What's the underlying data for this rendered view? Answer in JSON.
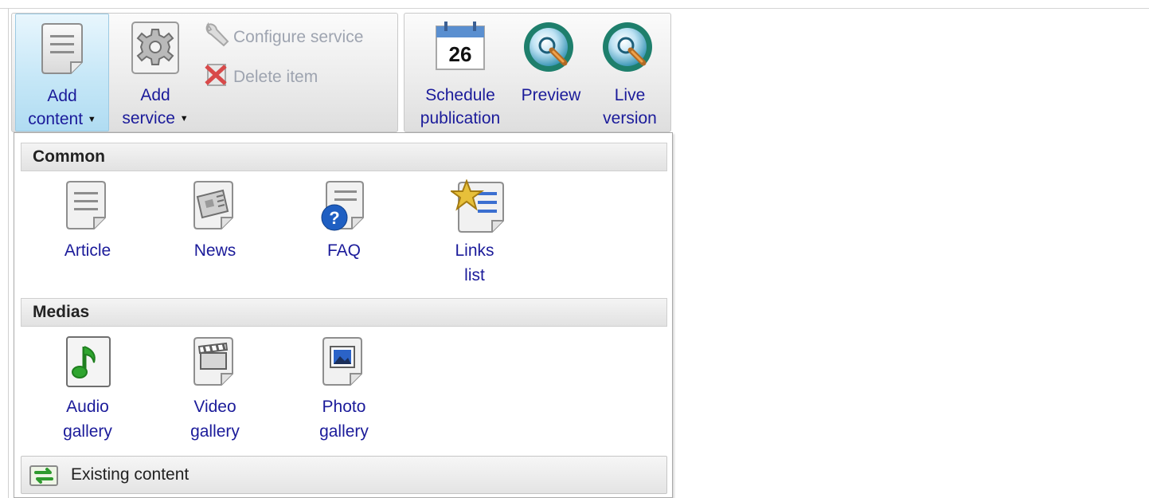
{
  "ribbon": {
    "add_content": {
      "line1": "Add",
      "line2": "content"
    },
    "add_service": {
      "line1": "Add",
      "line2": "service"
    },
    "configure_service": "Configure service",
    "delete_item": "Delete item",
    "schedule_publication": {
      "line1": "Schedule",
      "line2": "publication",
      "calendar_day": "26"
    },
    "preview": "Preview",
    "live_version": {
      "line1": "Live",
      "line2": "version"
    }
  },
  "dropdown": {
    "common": {
      "title": "Common",
      "items": [
        {
          "line1": "Article",
          "line2": ""
        },
        {
          "line1": "News",
          "line2": ""
        },
        {
          "line1": "FAQ",
          "line2": ""
        },
        {
          "line1": "Links",
          "line2": "list"
        }
      ]
    },
    "medias": {
      "title": "Medias",
      "items": [
        {
          "line1": "Audio",
          "line2": "gallery"
        },
        {
          "line1": "Video",
          "line2": "gallery"
        },
        {
          "line1": "Photo",
          "line2": "gallery"
        }
      ]
    },
    "existing_content": "Existing content"
  },
  "colors": {
    "label_blue": "#1b1b9a",
    "disabled_gray": "#9ea4b0",
    "active_button_bg": "#c6e7f7"
  }
}
